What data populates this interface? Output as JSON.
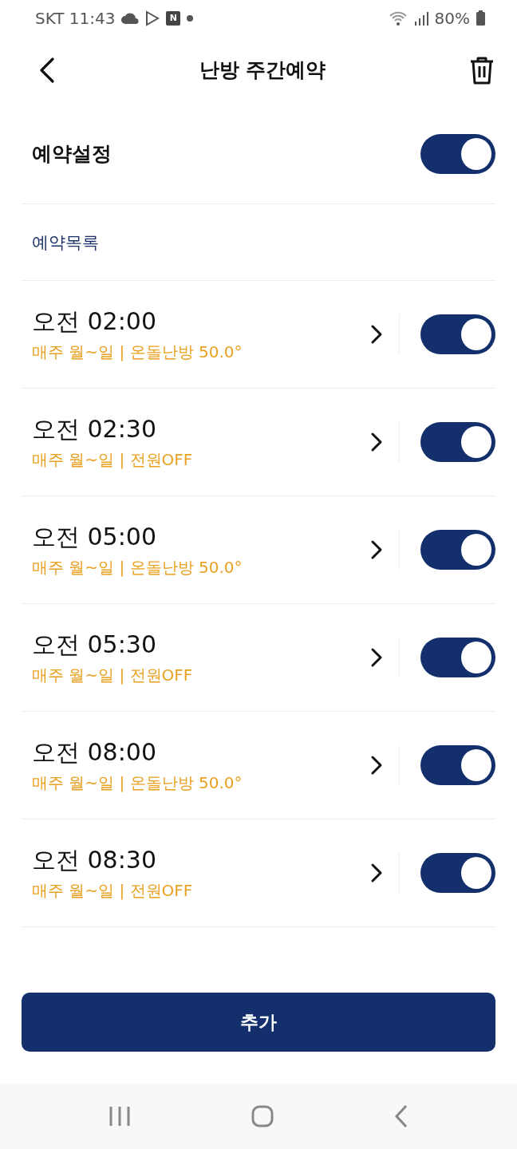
{
  "status_bar": {
    "carrier_time": "SKT 11:43",
    "app_badge": "N",
    "battery": "80%"
  },
  "header": {
    "title": "난방 주간예약"
  },
  "master": {
    "label": "예약설정",
    "on": true
  },
  "section_label": "예약목록",
  "schedules": [
    {
      "time": "오전 02:00",
      "detail": "매주 월~일 | 온돌난방 50.0°",
      "on": true
    },
    {
      "time": "오전 02:30",
      "detail": "매주 월~일 | 전원OFF",
      "on": true
    },
    {
      "time": "오전 05:00",
      "detail": "매주 월~일 | 온돌난방 50.0°",
      "on": true
    },
    {
      "time": "오전 05:30",
      "detail": "매주 월~일 | 전원OFF",
      "on": true
    },
    {
      "time": "오전 08:00",
      "detail": "매주 월~일 | 온돌난방 50.0°",
      "on": true
    },
    {
      "time": "오전 08:30",
      "detail": "매주 월~일 | 전원OFF",
      "on": true
    }
  ],
  "add_button": "추가"
}
